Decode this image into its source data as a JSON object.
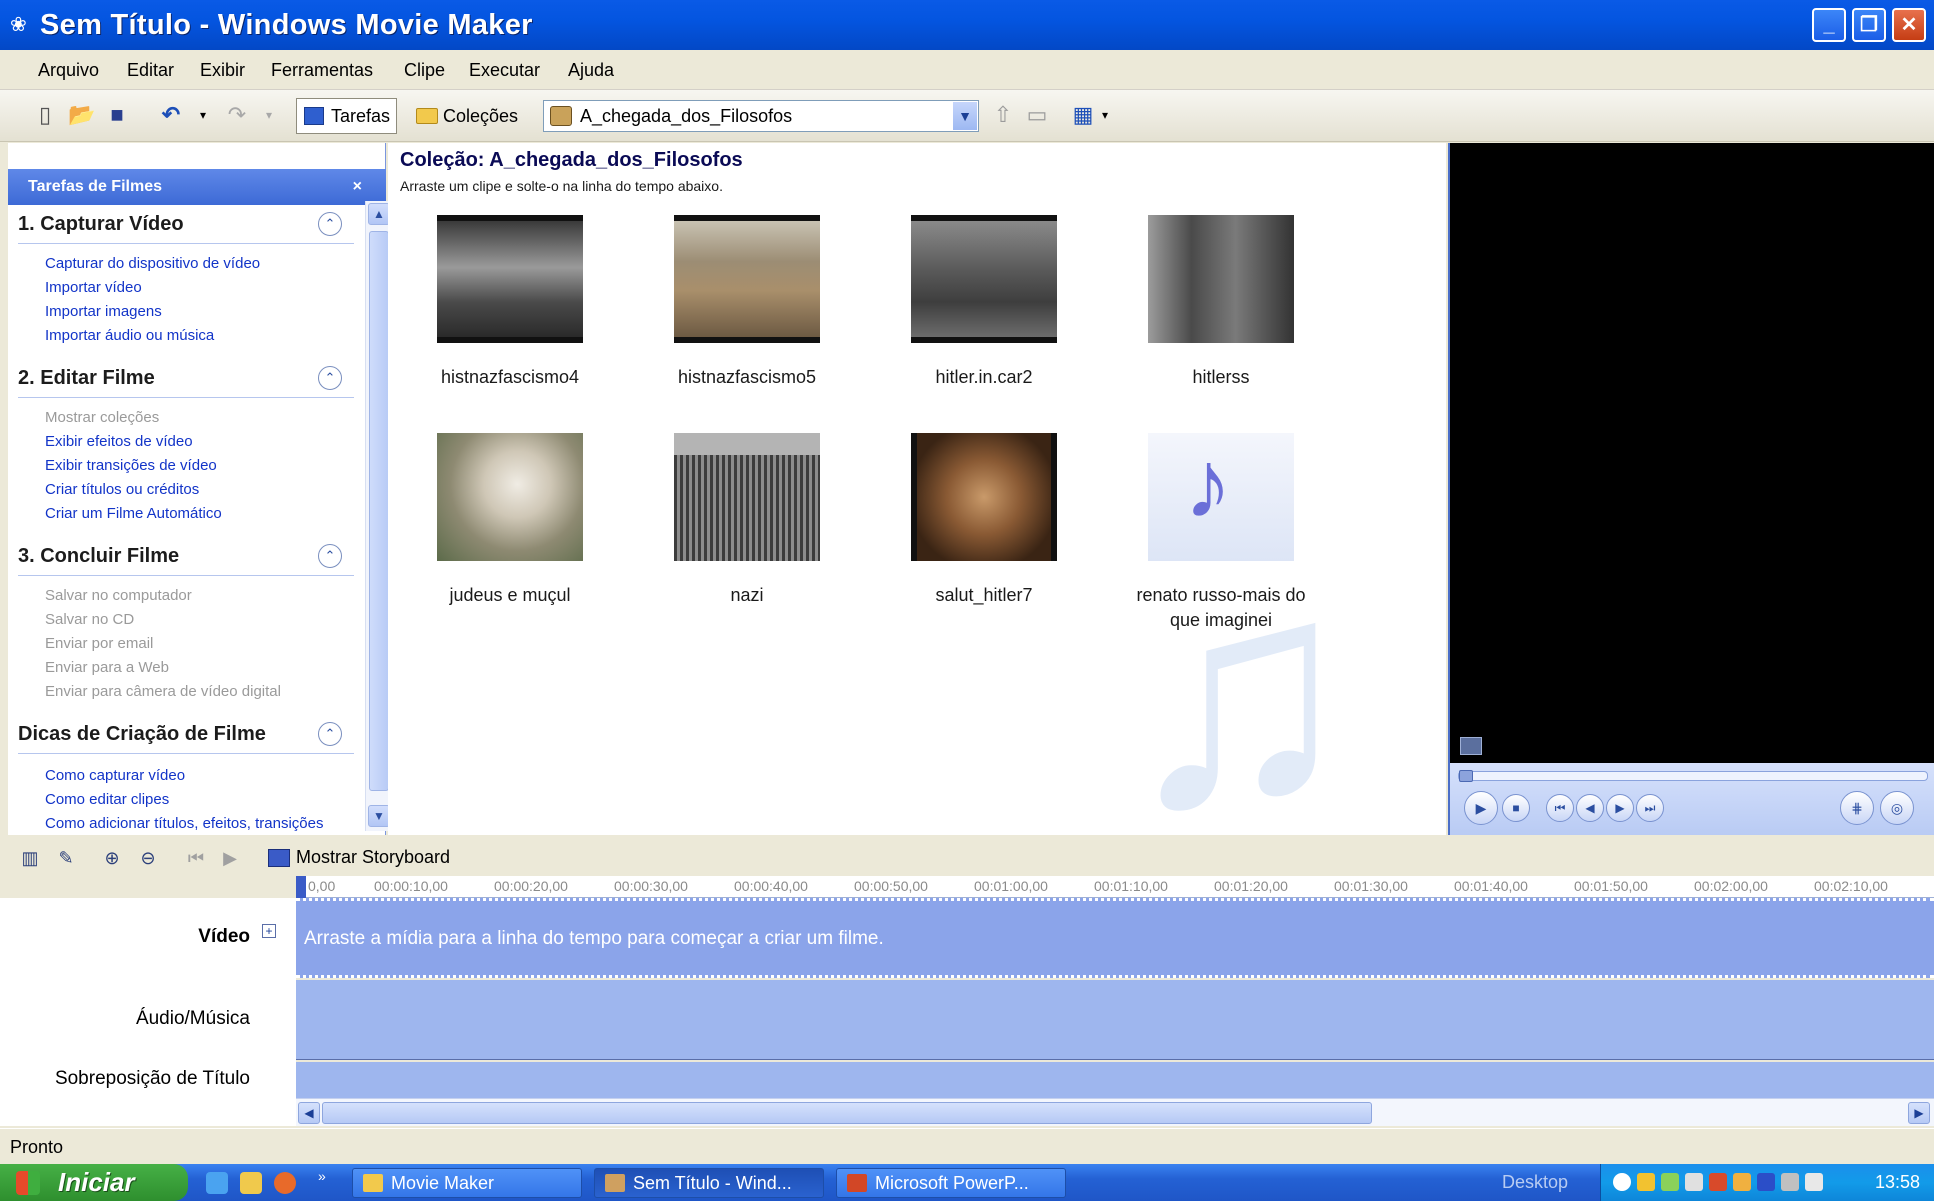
{
  "window": {
    "title": "Sem Título - Windows Movie Maker",
    "colors": {
      "titlebar": "#0455e0",
      "accent": "#3d6ad6",
      "timeline": "#9eb6ee"
    }
  },
  "menu": [
    "Arquivo",
    "Editar",
    "Exibir",
    "Ferramentas",
    "Clipe",
    "Executar",
    "Ajuda"
  ],
  "toolbar": {
    "tasks_label": "Tarefas",
    "collections_label": "Coleções",
    "collection_select": "A_chegada_dos_Filosofos"
  },
  "tasks_pane": {
    "header": "Tarefas de Filmes",
    "close": "×",
    "sections": [
      {
        "title": "1. Capturar Vídeo",
        "items": [
          {
            "label": "Capturar do dispositivo de vídeo",
            "enabled": true
          },
          {
            "label": "Importar vídeo",
            "enabled": true
          },
          {
            "label": "Importar imagens",
            "enabled": true
          },
          {
            "label": "Importar áudio ou música",
            "enabled": true
          }
        ]
      },
      {
        "title": "2. Editar Filme",
        "items": [
          {
            "label": "Mostrar coleções",
            "enabled": false
          },
          {
            "label": "Exibir efeitos de vídeo",
            "enabled": true
          },
          {
            "label": "Exibir transições de vídeo",
            "enabled": true
          },
          {
            "label": "Criar títulos ou créditos",
            "enabled": true
          },
          {
            "label": "Criar um Filme Automático",
            "enabled": true
          }
        ]
      },
      {
        "title": "3. Concluir Filme",
        "items": [
          {
            "label": "Salvar no computador",
            "enabled": false
          },
          {
            "label": "Salvar no CD",
            "enabled": false
          },
          {
            "label": "Enviar por email",
            "enabled": false
          },
          {
            "label": "Enviar para a Web",
            "enabled": false
          },
          {
            "label": "Enviar para câmera de vídeo digital",
            "enabled": false
          }
        ]
      },
      {
        "title": "Dicas de Criação de Filme",
        "items": [
          {
            "label": "Como capturar vídeo",
            "enabled": true
          },
          {
            "label": "Como editar clipes",
            "enabled": true
          },
          {
            "label": "Como adicionar títulos, efeitos, transições",
            "enabled": true
          }
        ]
      }
    ]
  },
  "collection": {
    "title": "Coleção: A_chegada_dos_Filosofos",
    "subtitle": "Arraste um clipe e solte-o na linha do tempo abaixo.",
    "clips": [
      {
        "name": "histnazfascismo4",
        "kind": "video"
      },
      {
        "name": "histnazfascismo5",
        "kind": "video"
      },
      {
        "name": "hitler.in.car2",
        "kind": "video"
      },
      {
        "name": "hitlerss",
        "kind": "video"
      },
      {
        "name": "judeus e muçul",
        "kind": "video"
      },
      {
        "name": "nazi",
        "kind": "video"
      },
      {
        "name": "salut_hitler7",
        "kind": "video"
      },
      {
        "name": "renato russo-mais do que imaginei",
        "kind": "audio"
      }
    ]
  },
  "timeline": {
    "storyboard_label": "Mostrar Storyboard",
    "ticks": [
      "0,00",
      "00:00:10,00",
      "00:00:20,00",
      "00:00:30,00",
      "00:00:40,00",
      "00:00:50,00",
      "00:01:00,00",
      "00:01:10,00",
      "00:01:20,00",
      "00:01:30,00",
      "00:01:40,00",
      "00:01:50,00",
      "00:02:00,00",
      "00:02:10,00"
    ],
    "tracks": {
      "video": "Vídeo",
      "audio": "Áudio/Música",
      "title_overlay": "Sobreposição de Título"
    },
    "empty_message": "Arraste a mídia para a linha do tempo para começar a criar um filme."
  },
  "status": "Pronto",
  "taskbar": {
    "start": "Iniciar",
    "apps": [
      "Movie Maker",
      "Sem Título - Wind...",
      "Microsoft PowerP..."
    ],
    "desktop": "Desktop",
    "clock": "13:58"
  }
}
